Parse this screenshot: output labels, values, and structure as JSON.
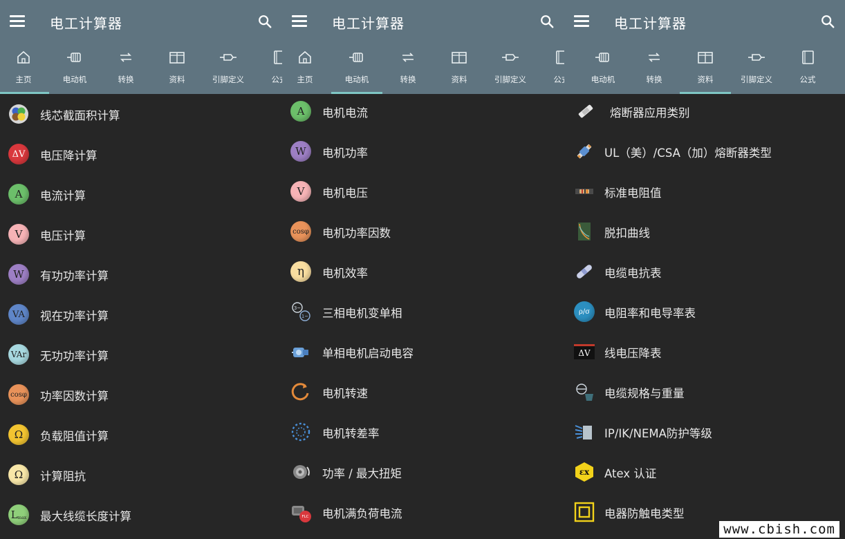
{
  "screens": [
    {
      "title": "电工计算器",
      "tabs": [
        {
          "label": "主页",
          "icon": "home-icon",
          "active": true
        },
        {
          "label": "电动机",
          "icon": "motor-icon",
          "active": false
        },
        {
          "label": "转换",
          "icon": "convert-icon",
          "active": false
        },
        {
          "label": "资料",
          "icon": "book-open-icon",
          "active": false
        },
        {
          "label": "引脚定义",
          "icon": "connector-icon",
          "active": false
        },
        {
          "label": "公式",
          "icon": "formula-book-icon",
          "active": false
        }
      ],
      "items": [
        {
          "label": "线芯截面积计算",
          "icon": "wire-cores-icon",
          "glyph": ""
        },
        {
          "label": "电压降计算",
          "icon": "voltage-drop-icon",
          "glyph": "ΔV"
        },
        {
          "label": "电流计算",
          "icon": "current-icon",
          "glyph": "A"
        },
        {
          "label": "电压计算",
          "icon": "voltage-icon",
          "glyph": "V"
        },
        {
          "label": "有功功率计算",
          "icon": "active-power-icon",
          "glyph": "W"
        },
        {
          "label": "视在功率计算",
          "icon": "apparent-power-icon",
          "glyph": "VA"
        },
        {
          "label": "无功功率计算",
          "icon": "reactive-power-icon",
          "glyph": "VAr"
        },
        {
          "label": "功率因数计算",
          "icon": "power-factor-icon",
          "glyph": "cosφ"
        },
        {
          "label": "负载阻值计算",
          "icon": "load-resistance-icon",
          "glyph": "Ω"
        },
        {
          "label": "计算阻抗",
          "icon": "impedance-icon",
          "glyph": "Ω"
        },
        {
          "label": "最大线缆长度计算",
          "icon": "max-cable-length-icon",
          "glyph": "L",
          "glyph_sub": "max"
        }
      ]
    },
    {
      "title": "电工计算器",
      "tabs": [
        {
          "label": "主页",
          "icon": "home-icon",
          "active": false
        },
        {
          "label": "电动机",
          "icon": "motor-icon",
          "active": true
        },
        {
          "label": "转换",
          "icon": "convert-icon",
          "active": false
        },
        {
          "label": "资料",
          "icon": "book-open-icon",
          "active": false
        },
        {
          "label": "引脚定义",
          "icon": "connector-icon",
          "active": false
        },
        {
          "label": "公式",
          "icon": "formula-book-icon",
          "active": false
        }
      ],
      "items": [
        {
          "label": "电机电流",
          "icon": "motor-current-icon",
          "glyph": "A"
        },
        {
          "label": "电机功率",
          "icon": "motor-power-icon",
          "glyph": "W"
        },
        {
          "label": "电机电压",
          "icon": "motor-voltage-icon",
          "glyph": "V"
        },
        {
          "label": "电机功率因数",
          "icon": "motor-power-factor-icon",
          "glyph": "cosφ"
        },
        {
          "label": "电机效率",
          "icon": "motor-efficiency-icon",
          "glyph": "η"
        },
        {
          "label": "三相电机变单相",
          "icon": "three-to-single-phase-icon",
          "glyph": ""
        },
        {
          "label": "单相电机启动电容",
          "icon": "start-capacitor-icon",
          "glyph": ""
        },
        {
          "label": "电机转速",
          "icon": "motor-speed-icon",
          "glyph": ""
        },
        {
          "label": "电机转差率",
          "icon": "motor-slip-icon",
          "glyph": ""
        },
        {
          "label": "功率 / 最大扭矩",
          "icon": "torque-icon",
          "glyph": ""
        },
        {
          "label": "电机满负荷电流",
          "icon": "full-load-current-icon",
          "glyph": "FLC"
        }
      ]
    },
    {
      "title": "电工计算器",
      "tabs": [
        {
          "label": "电动机",
          "icon": "motor-icon",
          "active": false
        },
        {
          "label": "转换",
          "icon": "convert-icon",
          "active": false
        },
        {
          "label": "资料",
          "icon": "book-open-icon",
          "active": true
        },
        {
          "label": "引脚定义",
          "icon": "connector-icon",
          "active": false
        },
        {
          "label": "公式",
          "icon": "formula-book-icon",
          "active": false
        }
      ],
      "items": [
        {
          "label": "熔断器应用类别",
          "icon": "fuse-category-icon",
          "glyph": ""
        },
        {
          "label": "UL（美）/CSA（加）熔断器类型",
          "icon": "fuse-type-icon",
          "glyph": ""
        },
        {
          "label": "标准电阻值",
          "icon": "resistor-icon",
          "glyph": ""
        },
        {
          "label": "脱扣曲线",
          "icon": "trip-curve-icon",
          "glyph": ""
        },
        {
          "label": "电缆电抗表",
          "icon": "cable-reactance-icon",
          "glyph": ""
        },
        {
          "label": "电阻率和电导率表",
          "icon": "resistivity-icon",
          "glyph": "ρ/σ"
        },
        {
          "label": "线电压降表",
          "icon": "line-voltage-drop-icon",
          "glyph": "ΔV"
        },
        {
          "label": "电缆规格与重量",
          "icon": "cable-weight-icon",
          "glyph": ""
        },
        {
          "label": "IP/IK/NEMA防护等级",
          "icon": "ip-rating-icon",
          "glyph": ""
        },
        {
          "label": "Atex 认证",
          "icon": "atex-icon",
          "glyph": "εx"
        },
        {
          "label": "电器防触电类型",
          "icon": "shock-protection-class-icon",
          "glyph": ""
        }
      ]
    }
  ],
  "watermark": "www.cbish.com"
}
